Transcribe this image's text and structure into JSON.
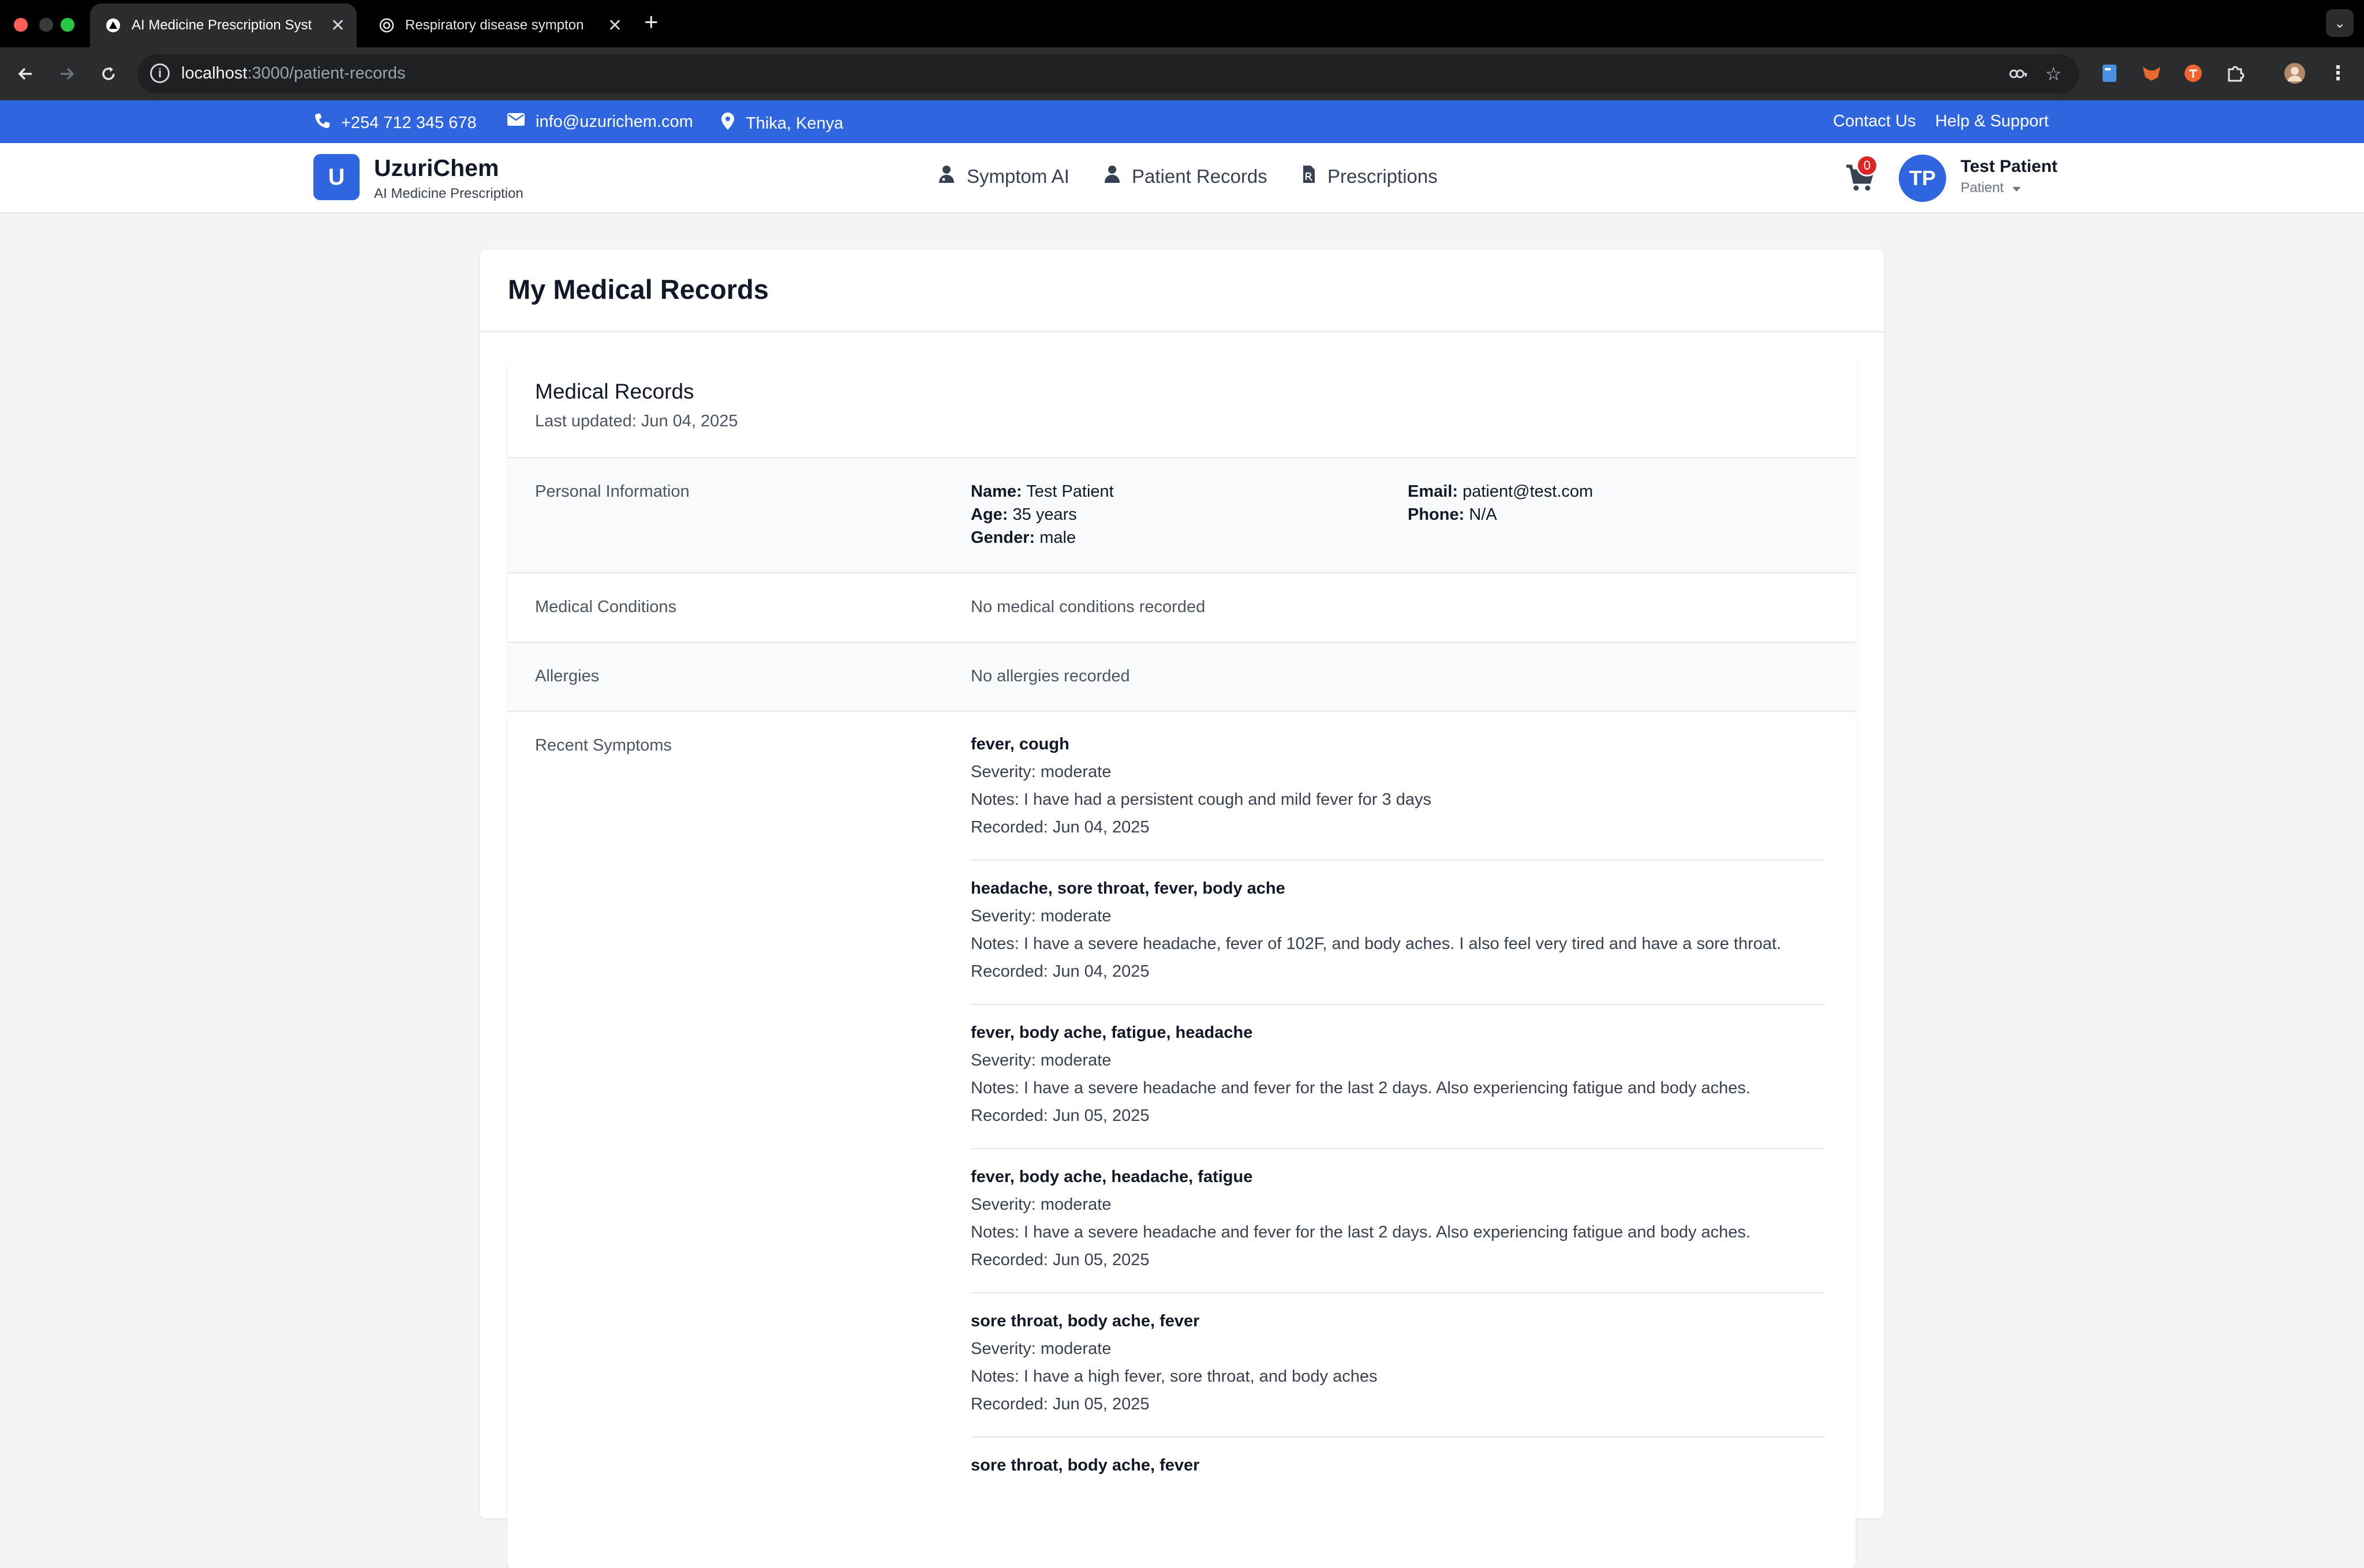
{
  "browser": {
    "tabs": [
      {
        "title": "AI Medicine Prescription Syst",
        "active": true
      },
      {
        "title": "Respiratory disease sympton",
        "active": false
      }
    ],
    "url_host": "localhost",
    "url_path": ":3000/patient-records"
  },
  "topbar": {
    "phone": "+254 712 345 678",
    "email": "info@uzurichem.com",
    "location": "Thika, Kenya",
    "links": [
      "Contact Us",
      "Help & Support"
    ]
  },
  "header": {
    "logo_letter": "U",
    "brand": "UzuriChem",
    "brand_sub": "AI Medicine Prescription",
    "nav": [
      "Symptom AI",
      "Patient Records",
      "Prescriptions"
    ],
    "cart_count": "0",
    "user_initials": "TP",
    "user_name": "Test Patient",
    "user_role": "Patient"
  },
  "page": {
    "title": "My Medical Records",
    "section_title": "Medical Records",
    "last_updated": "Last updated: Jun 04, 2025"
  },
  "personal": {
    "label": "Personal Information",
    "name_label": "Name:",
    "name": "Test Patient",
    "age_label": "Age:",
    "age": "35 years",
    "gender_label": "Gender:",
    "gender": "male",
    "email_label": "Email:",
    "email": "patient@test.com",
    "phone_label": "Phone:",
    "phone": "N/A"
  },
  "conditions": {
    "label": "Medical Conditions",
    "value": "No medical conditions recorded"
  },
  "allergies": {
    "label": "Allergies",
    "value": "No allergies recorded"
  },
  "symptoms": {
    "label": "Recent Symptoms",
    "items": [
      {
        "title": "fever, cough",
        "severity": "Severity: moderate",
        "notes": "Notes: I have had a persistent cough and mild fever for 3 days",
        "recorded": "Recorded: Jun 04, 2025"
      },
      {
        "title": "headache, sore throat, fever, body ache",
        "severity": "Severity: moderate",
        "notes": "Notes: I have a severe headache, fever of 102F, and body aches. I also feel very tired and have a sore throat.",
        "recorded": "Recorded: Jun 04, 2025"
      },
      {
        "title": "fever, body ache, fatigue, headache",
        "severity": "Severity: moderate",
        "notes": "Notes: I have a severe headache and fever for the last 2 days. Also experiencing fatigue and body aches.",
        "recorded": "Recorded: Jun 05, 2025"
      },
      {
        "title": "fever, body ache, headache, fatigue",
        "severity": "Severity: moderate",
        "notes": "Notes: I have a severe headache and fever for the last 2 days. Also experiencing fatigue and body aches.",
        "recorded": "Recorded: Jun 05, 2025"
      },
      {
        "title": "sore throat, body ache, fever",
        "severity": "Severity: moderate",
        "notes": "Notes: I have a high fever, sore throat, and body aches",
        "recorded": "Recorded: Jun 05, 2025"
      },
      {
        "title": "sore throat, body ache, fever",
        "severity": "",
        "notes": "",
        "recorded": ""
      }
    ]
  },
  "colors": {
    "brand": "#2f66e0",
    "badge": "#dc2626"
  }
}
